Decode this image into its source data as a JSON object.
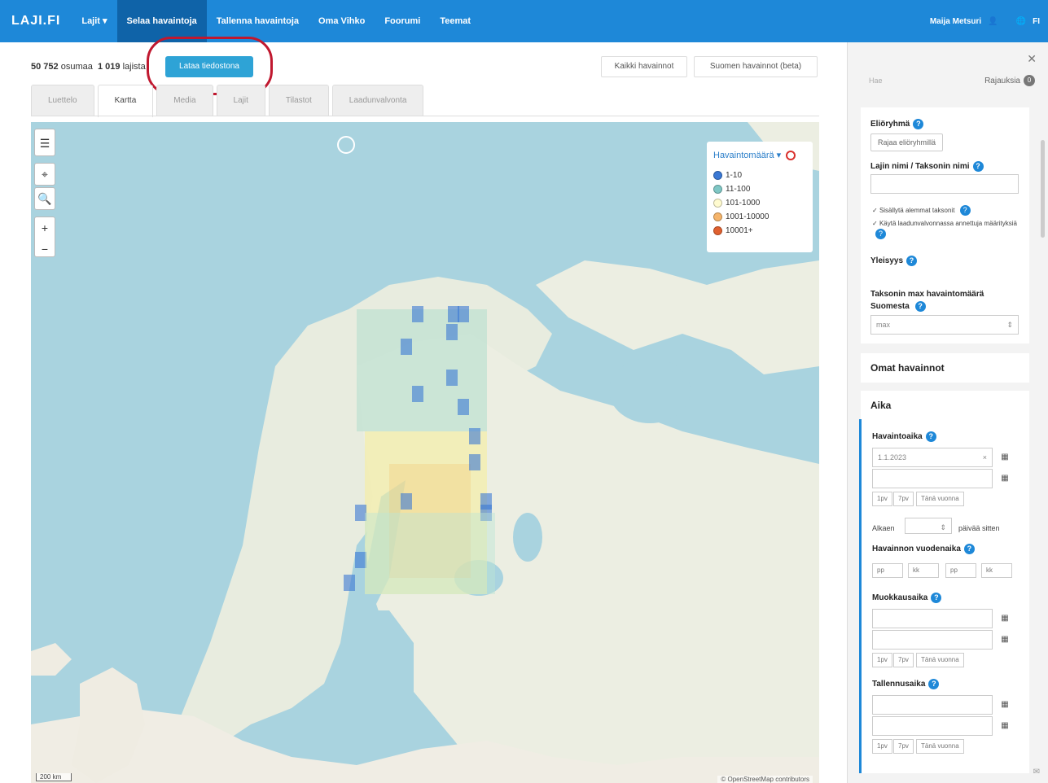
{
  "nav": {
    "logo": "LAJI.FI",
    "items": [
      "Lajit ▾",
      "Selaa havaintoja",
      "Tallenna havaintoja",
      "Oma Vihko",
      "Foorumi",
      "Teemat"
    ],
    "user": "Maija Metsuri",
    "lang": "FI"
  },
  "results": {
    "count": "50 752",
    "count_label": "osumaa",
    "species": "1 019",
    "species_label": "lajista",
    "download_button": "Lataa tiedostona"
  },
  "obs_buttons": [
    "Kaikki havainnot",
    "Suomen havainnot (beta)"
  ],
  "tabs": [
    "Luettelo",
    "Kartta",
    "Media",
    "Lajit",
    "Tilastot",
    "Laadunvalvonta"
  ],
  "active_tab": 1,
  "map": {
    "legend_title": "Havaintomäärä ▾",
    "legend": [
      {
        "label": "1-10",
        "color": "#3a78d4"
      },
      {
        "label": "11-100",
        "color": "#7fc7c5"
      },
      {
        "label": "101-1000",
        "color": "#fffbd0"
      },
      {
        "label": "1001-10000",
        "color": "#f5b46a"
      },
      {
        "label": "10001+",
        "color": "#e0602f"
      }
    ],
    "scale": "200 km",
    "attribution": "© OpenStreetMap contributors"
  },
  "sidebar": {
    "filter_placeholder": "Hae",
    "rajauksia_label": "Rajauksia",
    "rajauksia_count": "0",
    "eliorygma_label": "Eliöryhmä",
    "eliorygma_button": "Rajaa eliöryhmillä",
    "taxon_label": "Lajin nimi / Taksonin nimi",
    "chk1": "Sisällytä alemmat taksonit",
    "chk2": "Käytä laadunvalvonnassa annettuja määrityksiä",
    "yleisyys": "Yleisyys",
    "taxon_max_label": "Taksonin max havaintomäärä Suomesta",
    "taxon_max_select": "max",
    "omat": "Omat havainnot",
    "aika": "Aika",
    "havaintoaika": "Havaintoaika",
    "havaintoaika_value": "1.1.2023",
    "quick": [
      "1pv",
      "7pv",
      "Tänä vuonna"
    ],
    "alkaen": "Alkaen",
    "paivaa": "päivää sitten",
    "vuodenaika": "Havainnon vuodenaika",
    "pp": "pp",
    "kk": "kk",
    "muokkausaika": "Muokkausaika",
    "tallennusaika": "Tallennusaika"
  }
}
